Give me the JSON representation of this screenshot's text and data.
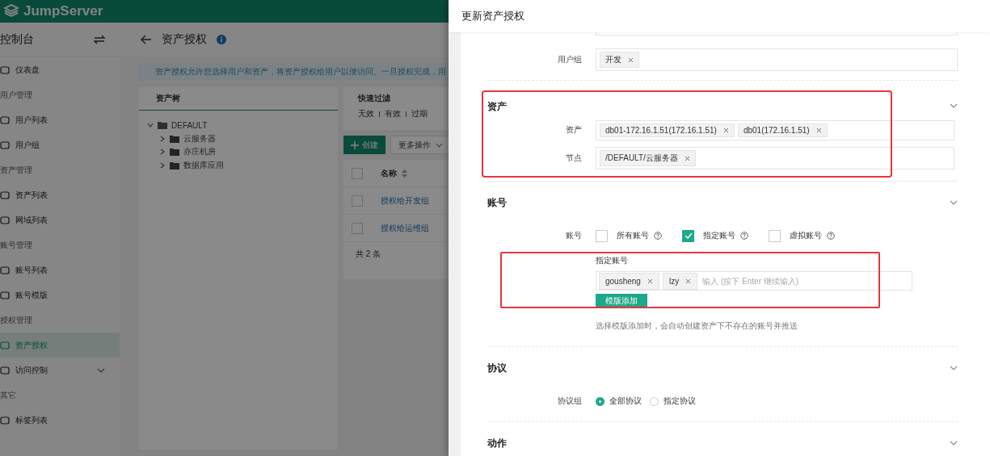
{
  "app": {
    "logo": "JumpServer"
  },
  "sidebar": {
    "title": "控制台",
    "items": [
      {
        "kind": "item",
        "label": "仪表盘",
        "selected": false
      },
      {
        "kind": "group",
        "label": "用户管理"
      },
      {
        "kind": "item",
        "label": "用户列表",
        "selected": false
      },
      {
        "kind": "item",
        "label": "用户组",
        "selected": false
      },
      {
        "kind": "group",
        "label": "资产管理"
      },
      {
        "kind": "item",
        "label": "资产列表",
        "selected": false
      },
      {
        "kind": "item",
        "label": "网域列表",
        "selected": false
      },
      {
        "kind": "group",
        "label": "账号管理"
      },
      {
        "kind": "item",
        "label": "账号列表",
        "selected": false
      },
      {
        "kind": "item",
        "label": "账号模版",
        "selected": false
      },
      {
        "kind": "group",
        "label": "授权管理"
      },
      {
        "kind": "item",
        "label": "资产授权",
        "selected": true
      },
      {
        "kind": "submenu",
        "label": "访问控制",
        "selected": false
      },
      {
        "kind": "group",
        "label": "其它"
      },
      {
        "kind": "item",
        "label": "标签列表",
        "selected": false
      }
    ]
  },
  "page": {
    "title": "资产授权",
    "alert": "资产授权允许您选择用户和资产，将资产授权给用户以便访问。一旦授权完成，用"
  },
  "tree": {
    "tab": "资产树",
    "root": {
      "label": "DEFAULT",
      "expanded": true,
      "children": [
        {
          "label": "云服务器",
          "expanded": false
        },
        {
          "label": "亦庄机房",
          "expanded": false
        },
        {
          "label": "数据库应用",
          "expanded": false
        }
      ]
    }
  },
  "filter": {
    "title": "快速过滤",
    "options": [
      "无效",
      "有效",
      "过期"
    ]
  },
  "toolbar": {
    "create": "创建",
    "more": "更多操作"
  },
  "table": {
    "header_selected": false,
    "columns": [
      "名称"
    ],
    "rows": [
      {
        "name": "授权给开发组",
        "selected": false
      },
      {
        "name": "授权给运维组",
        "selected": false
      }
    ],
    "footer": "共 2 条"
  },
  "drawer": {
    "title": "更新资产授权",
    "user_group": {
      "label": "用户组",
      "tags": [
        "开发"
      ]
    },
    "assets": {
      "title": "资产",
      "highlighted": true,
      "fields": [
        {
          "label": "资产",
          "tags": [
            "db01-172.16.1.51(172.16.1.51)",
            "db01(172.16.1.51)"
          ]
        },
        {
          "label": "节点",
          "tags": [
            "/DEFAULT/云服务器"
          ]
        }
      ]
    },
    "accounts": {
      "title": "账号",
      "label": "账号",
      "options": [
        {
          "label": "所有账号",
          "checked": false
        },
        {
          "label": "指定账号",
          "checked": true
        },
        {
          "label": "虚拟账号",
          "checked": false
        }
      ],
      "specified": {
        "highlighted": true,
        "label": "指定账号",
        "tags": [
          "gousheng",
          "lzy"
        ],
        "placeholder": "输入 (按下 Enter 继续输入)",
        "button": "模版添加",
        "help": "选择模版添加时，会自动创建资产下不存在的账号并推送"
      }
    },
    "protocols": {
      "title": "协议",
      "label": "协议组",
      "options": [
        {
          "label": "全部协议",
          "selected": true
        },
        {
          "label": "指定协议",
          "selected": false
        }
      ]
    },
    "actions": {
      "title": "动作"
    }
  }
}
